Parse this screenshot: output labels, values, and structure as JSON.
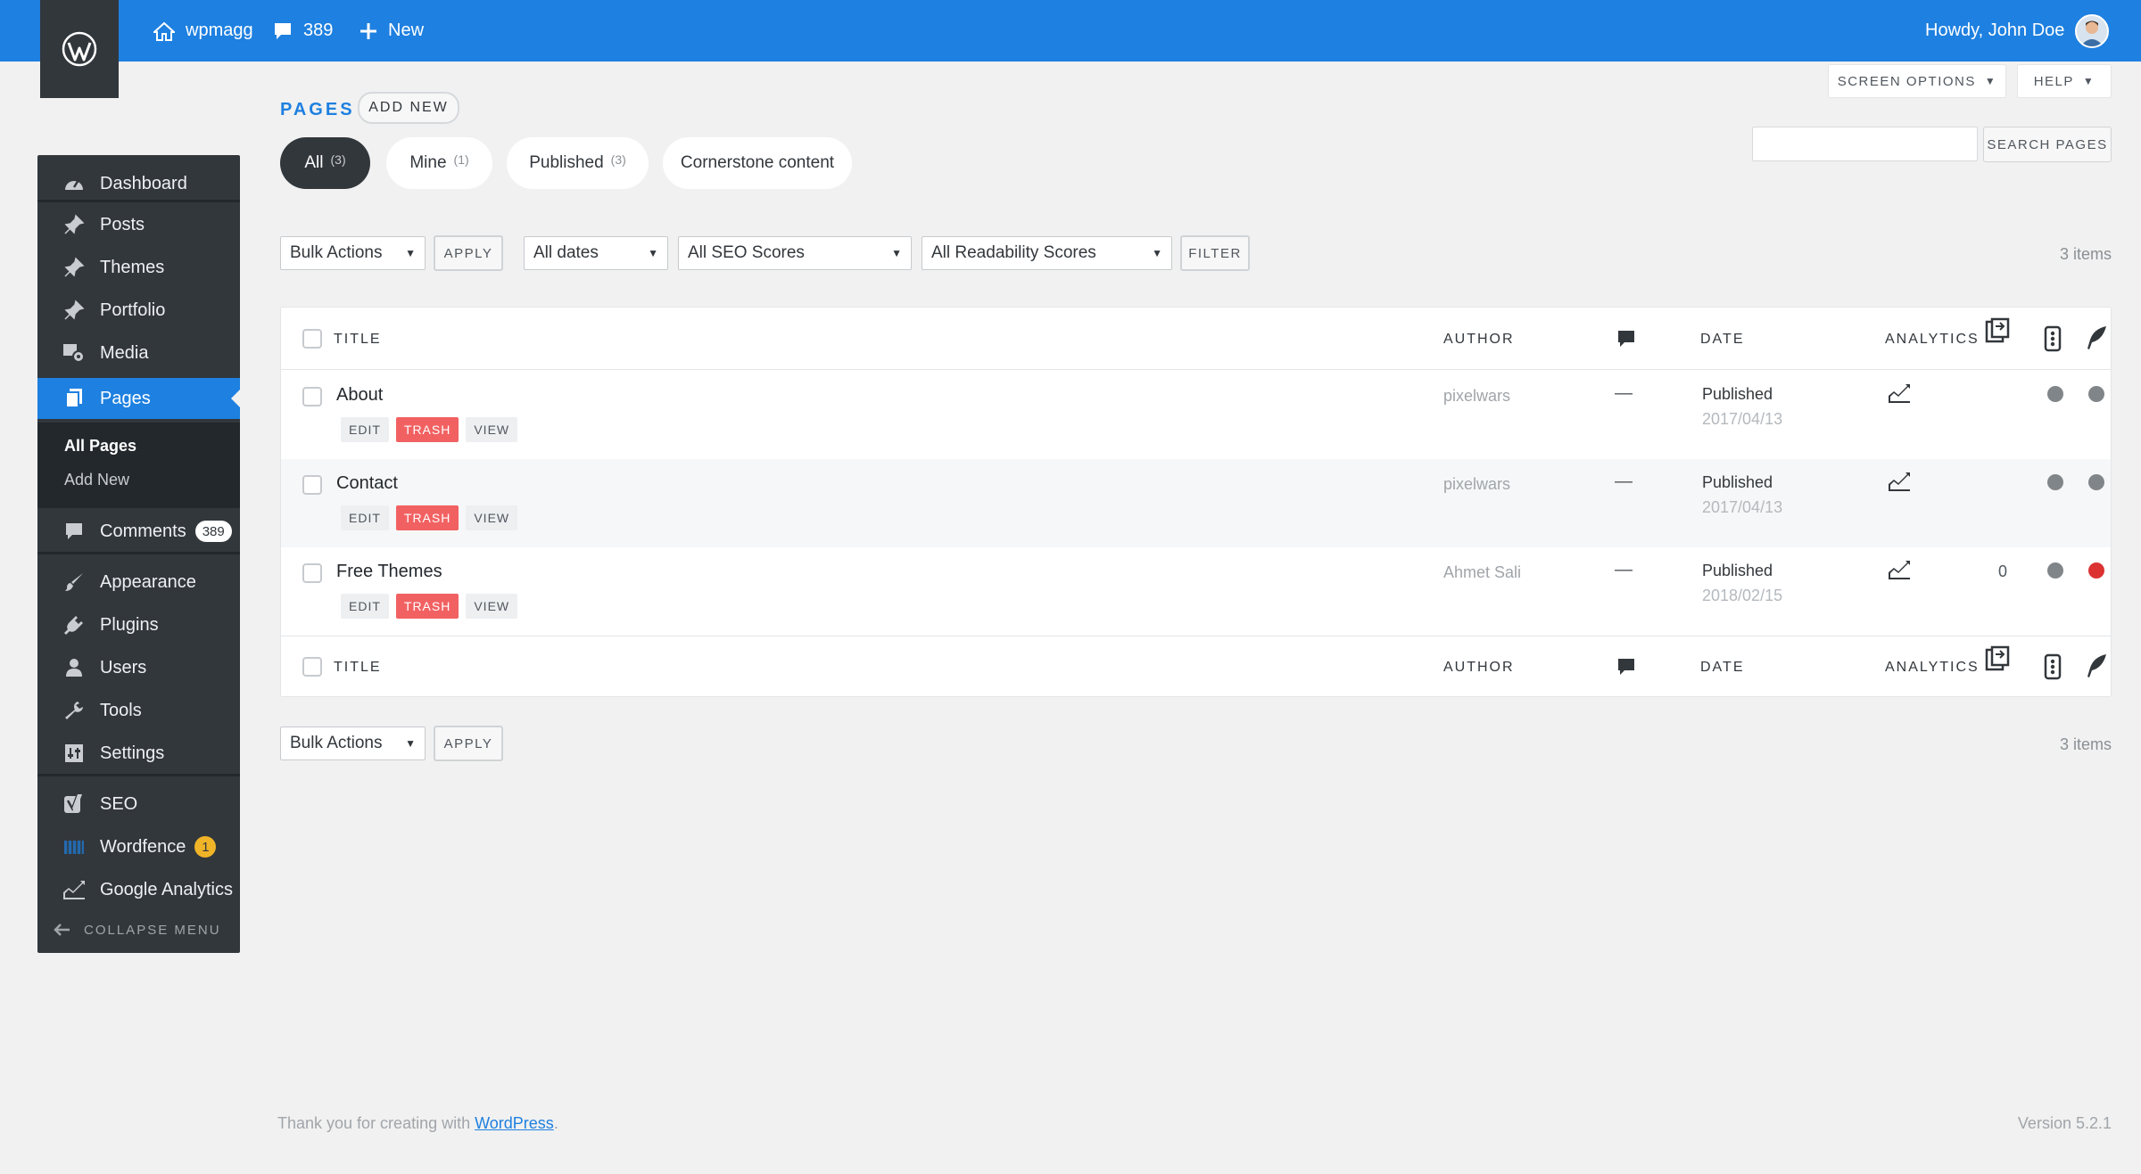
{
  "topbar": {
    "site_name": "wpmagg",
    "comments_count": "389",
    "new_label": "New",
    "greeting": "Howdy, John Doe"
  },
  "sidebar": {
    "items": [
      {
        "label": "Dashboard",
        "icon": "dashboard-icon"
      },
      {
        "label": "Posts",
        "icon": "pin-icon"
      },
      {
        "label": "Themes",
        "icon": "pin-icon"
      },
      {
        "label": "Portfolio",
        "icon": "pin-icon"
      },
      {
        "label": "Media",
        "icon": "media-icon"
      },
      {
        "label": "Pages",
        "icon": "pages-icon"
      },
      {
        "label": "Comments",
        "icon": "comment-icon",
        "badge": "389"
      },
      {
        "label": "Appearance",
        "icon": "brush-icon"
      },
      {
        "label": "Plugins",
        "icon": "plugin-icon"
      },
      {
        "label": "Users",
        "icon": "user-icon"
      },
      {
        "label": "Tools",
        "icon": "wrench-icon"
      },
      {
        "label": "Settings",
        "icon": "settings-icon"
      },
      {
        "label": "SEO",
        "icon": "yoast-icon"
      },
      {
        "label": "Wordfence",
        "icon": "wordfence-icon",
        "badge": "1"
      },
      {
        "label": "Google Analytics",
        "icon": "analytics-icon"
      }
    ],
    "submenu": [
      "All Pages",
      "Add New"
    ],
    "collapse_label": "COLLAPSE MENU"
  },
  "header": {
    "title": "PAGES",
    "add_new": "ADD NEW",
    "screen_options": "SCREEN OPTIONS",
    "help": "HELP"
  },
  "filters": [
    {
      "label": "All",
      "count": "(3)"
    },
    {
      "label": "Mine",
      "count": "(1)"
    },
    {
      "label": "Published",
      "count": "(3)"
    },
    {
      "label": "Cornerstone content",
      "count": ""
    }
  ],
  "search": {
    "placeholder": "",
    "button": "SEARCH PAGES"
  },
  "toolbar": {
    "bulk_actions": "Bulk Actions",
    "apply": "APPLY",
    "dates": "All dates",
    "seo_scores": "All SEO Scores",
    "readability": "All Readability Scores",
    "filter": "FILTER",
    "items_count": "3 items"
  },
  "table": {
    "columns": {
      "title": "TITLE",
      "author": "AUTHOR",
      "date": "DATE",
      "analytics": "ANALYTICS"
    },
    "row_actions": {
      "edit": "EDIT",
      "trash": "TRASH",
      "view": "VIEW"
    },
    "rows": [
      {
        "title": "About",
        "author": "pixelwars",
        "comments": "—",
        "status": "Published",
        "date": "2017/04/13",
        "links": "",
        "seo_color": "#808589",
        "readability_color": "#808589"
      },
      {
        "title": "Contact",
        "author": "pixelwars",
        "comments": "—",
        "status": "Published",
        "date": "2017/04/13",
        "links": "",
        "seo_color": "#808589",
        "readability_color": "#808589"
      },
      {
        "title": "Free Themes",
        "author": "Ahmet Sali",
        "comments": "—",
        "status": "Published",
        "date": "2018/02/15",
        "links": "0",
        "seo_color": "#808589",
        "readability_color": "#dc3232"
      }
    ]
  },
  "footer": {
    "thanks_prefix": "Thank you for creating with ",
    "thanks_link": "WordPress",
    "thanks_suffix": ".",
    "version": "Version 5.2.1"
  }
}
